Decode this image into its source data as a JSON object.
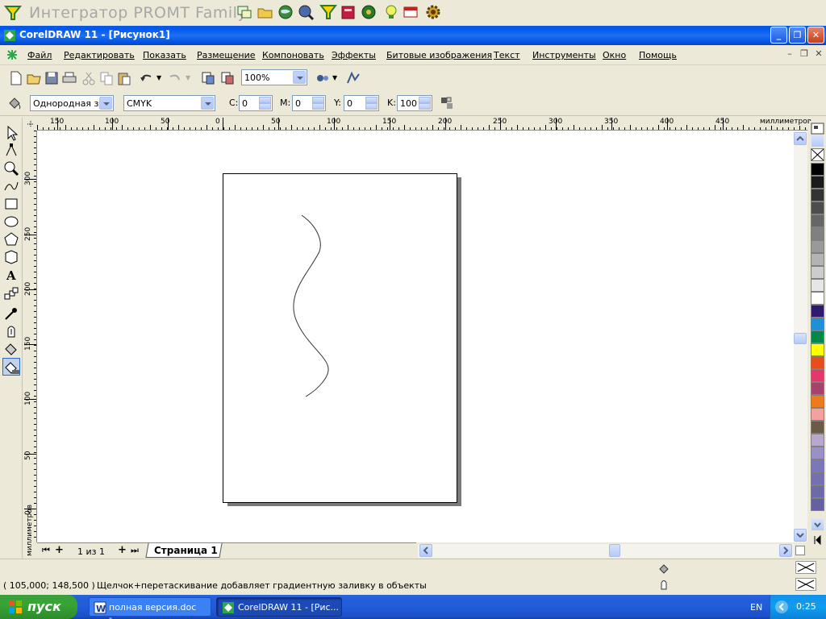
{
  "promt": {
    "title": "Интегратор PROMT Family",
    "buttons": [
      "translate-icon",
      "open-folder-icon",
      "globe-search-icon",
      "globe-magnify-icon",
      "funnel-icon",
      "book-icon",
      "world-icon",
      "lightbulb-icon",
      "dictionary-icon",
      "settings-gear-icon"
    ]
  },
  "window": {
    "title": "CorelDRAW 11 - [Рисунок1]",
    "minimize": "_",
    "restore": "❐",
    "close": "✕"
  },
  "menu": {
    "items": [
      "Файл",
      "Редактировать",
      "Показать",
      "Размещение",
      "Компоновать",
      "Эффекты",
      "Битовые изображения",
      "Текст",
      "Инструменты",
      "Окно",
      "Помощь"
    ]
  },
  "toolbar": {
    "zoom": "100%"
  },
  "properties": {
    "fill_type": "Однородная з...",
    "color_model": "CMYK",
    "c_label": "C:",
    "c_value": "0",
    "m_label": "M:",
    "m_value": "0",
    "y_label": "Y:",
    "y_value": "0",
    "k_label": "K:",
    "k_value": "100"
  },
  "ruler": {
    "unit": "миллиметров",
    "h_labels": [
      "150",
      "100",
      "50",
      "0",
      "50",
      "100",
      "150",
      "200",
      "250",
      "300",
      "350",
      "400",
      "450"
    ],
    "v_labels": [
      "300",
      "250",
      "200",
      "150",
      "100",
      "50",
      "0"
    ]
  },
  "palette": {
    "colors": [
      "#000000",
      "#1a1a1a",
      "#333333",
      "#4d4d4d",
      "#666666",
      "#808080",
      "#999999",
      "#b3b3b3",
      "#cccccc",
      "#e6e6e6",
      "#ffffff",
      "#2e1a6e",
      "#1e90d8",
      "#008a4a",
      "#ffff00",
      "#e84e1b",
      "#e4386d",
      "#a8426d",
      "#ee7a1e",
      "#f5a0a0",
      "#6b5a48",
      "#b8a8d0",
      "#9a90c8",
      "#7a78b8",
      "#7570b0",
      "#6e6aa8",
      "#665fa0"
    ]
  },
  "page_nav": {
    "count": "1 из 1",
    "tab": "Страница 1"
  },
  "status": {
    "coords": "( 105,000; 148,500 )",
    "message": "Щелчок+перетаскивание добавляет градиентную заливку в объекты"
  },
  "taskbar": {
    "start": "пуск",
    "tasks": [
      "полная версия.doc -...",
      "CorelDRAW 11 - [Рис..."
    ],
    "lang": "EN",
    "clock": "0:25"
  }
}
